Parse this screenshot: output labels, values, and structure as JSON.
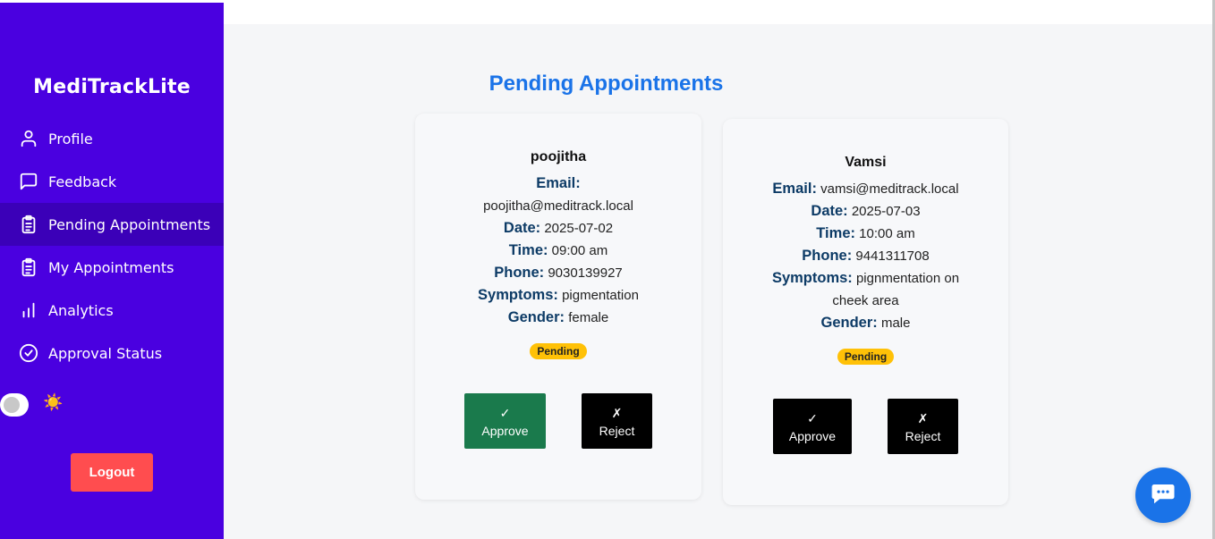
{
  "app": {
    "brand": "MediTrackLite"
  },
  "sidebar": {
    "items": [
      {
        "label": "Profile",
        "icon": "user-icon"
      },
      {
        "label": "Feedback",
        "icon": "chat-square-icon"
      },
      {
        "label": "Pending Appointments",
        "icon": "clipboard-list-icon",
        "active": true
      },
      {
        "label": "My Appointments",
        "icon": "clipboard-list-icon"
      },
      {
        "label": "Analytics",
        "icon": "bar-chart-icon"
      },
      {
        "label": "Approval Status",
        "icon": "check-circle-icon"
      }
    ],
    "theme_icon": "☀️",
    "logout_label": "Logout"
  },
  "main": {
    "title": "Pending Appointments",
    "labels": {
      "email": "Email:",
      "date": "Date:",
      "time": "Time:",
      "phone": "Phone:",
      "symptoms": "Symptoms:",
      "gender": "Gender:"
    },
    "appointments": [
      {
        "name": "poojitha",
        "email": "poojitha@meditrack.local",
        "date": "2025-07-02",
        "time": "09:00 am",
        "phone": "9030139927",
        "symptoms": "pigmentation",
        "gender": "female",
        "status": "Pending",
        "approve_label": "Approve",
        "approve_glyph": "✓",
        "reject_label": "Reject",
        "reject_glyph": "✗"
      },
      {
        "name": "Vamsi",
        "email": "vamsi@meditrack.local",
        "date": "2025-07-03",
        "time": "10:00 am",
        "phone": "9441311708",
        "symptoms": "pignmentation on cheek area",
        "gender": "male",
        "status": "Pending",
        "approve_label": "Approve",
        "approve_glyph": "✓",
        "reject_label": "Reject",
        "reject_glyph": "✗"
      }
    ]
  },
  "colors": {
    "sidebar_bg": "#4a00e0",
    "active_item_bg": "#3b00b8",
    "title_blue": "#1a73e8",
    "approve_green": "#1a7a4c",
    "logout_red": "#ff4d4f",
    "badge_yellow": "#ffc107"
  }
}
